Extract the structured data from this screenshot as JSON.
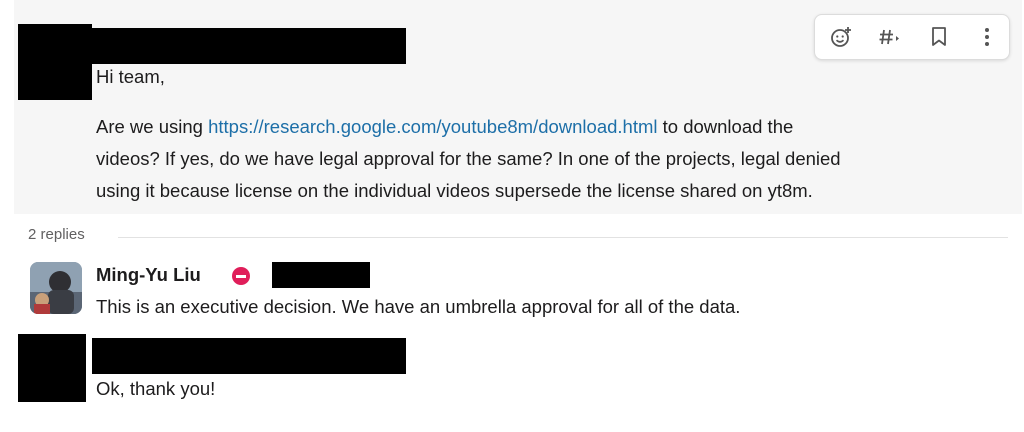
{
  "messages": [
    {
      "author": "",
      "greeting": "Hi team,",
      "link": "https://research.google.com/youtube8m/download.html",
      "line1_after_link": "to download the",
      "line2": "videos? If yes, do we have legal approval for the same? In one of the projects, legal denied",
      "line3": "using it because license on the individual videos supersede the license shared on yt8m."
    }
  ],
  "hover_toolbar": {
    "icons": [
      "add-reaction-icon",
      "channel-hash-icon",
      "bookmark-icon",
      "more-actions-icon"
    ]
  },
  "thread": {
    "replies_label": "2 replies",
    "replies": [
      {
        "author": "Ming-Yu Liu",
        "status_icon": "do-not-disturb-icon",
        "text": "This is an executive decision. We have an umbrella approval for all of the data."
      },
      {
        "author": "",
        "text": "Ok, thank you!"
      }
    ]
  },
  "colors": {
    "link": "#1d6fa8",
    "status_dnd": "#e01e5a",
    "hover_background": "#f6f6f6"
  }
}
